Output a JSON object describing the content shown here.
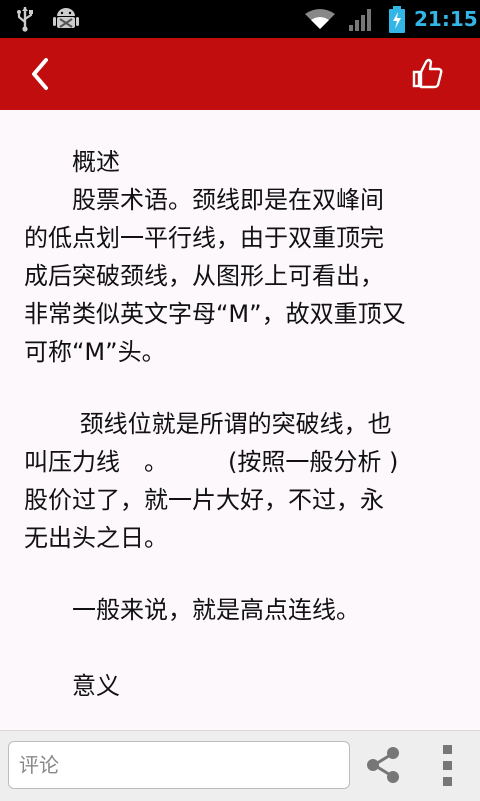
{
  "status_bar": {
    "time": "21:15",
    "icons": [
      "usb-icon",
      "android-debug-icon",
      "wifi-icon",
      "signal-icon",
      "battery-charging-icon"
    ],
    "time_color": "#33b5e5"
  },
  "app_bar": {
    "color": "#c10d0d",
    "back_icon": "back-chevron-icon",
    "like_icon": "thumbs-up-icon"
  },
  "article": {
    "lines": [
      "　　概述",
      "　　股票术语。颈线即是在双峰间",
      "的低点划一平行线，由于双重顶完",
      "成后突破颈线，从图形上可看出，",
      "非常类似英文字母“M”，故双重顶又",
      "可称“M”头。",
      "",
      "　　 颈线位就是所谓的突破线，也",
      "叫压力线　。　　　(按照一般分析 )",
      "股价过了，就一片大好，不过，永",
      "无出头之日。",
      "",
      "　　一般来说，就是高点连线。",
      "",
      "　　意义"
    ]
  },
  "bottom_bar": {
    "comment_placeholder": "评论",
    "share_icon": "share-icon",
    "menu_icon": "overflow-menu-icon"
  }
}
